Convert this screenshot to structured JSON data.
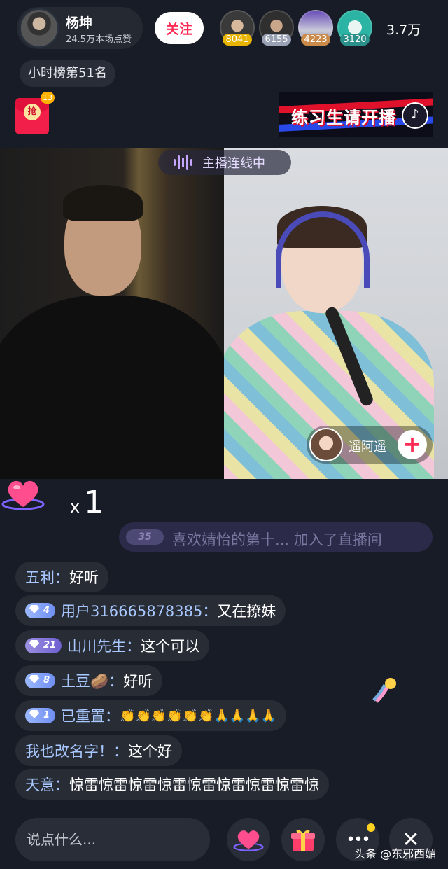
{
  "host": {
    "name": "杨坤",
    "likes": "24.5万本场点赞",
    "follow_label": "关注"
  },
  "viewers": [
    {
      "count": "8041",
      "badge_color": "#e8b400"
    },
    {
      "count": "6155",
      "badge_color": "#9aa3b5"
    },
    {
      "count": "4223",
      "badge_color": "#c98a4a"
    },
    {
      "count": "3120",
      "badge_color": "#2b8f8a"
    }
  ],
  "viewer_total": "3.7万",
  "rank": "小时榜第51名",
  "red_packet": {
    "label": "抢",
    "badge": "13"
  },
  "banner": {
    "text": "练习生请开播"
  },
  "link": {
    "status": "主播连线中"
  },
  "guest": {
    "name": "遥阿遥",
    "add_label": "+"
  },
  "like_combo": {
    "x": "x",
    "count": "1"
  },
  "join": {
    "level": "35",
    "text": "喜欢婧怡的第十... 加入了直播间"
  },
  "comments": [
    {
      "user": "五利",
      "sep": "：",
      "text": "好听"
    },
    {
      "level": "4",
      "user": "用户316665878385",
      "sep": "：",
      "text": "又在撩妹"
    },
    {
      "level": "21",
      "user": "山川先生",
      "sep": "：",
      "text": "这个可以"
    },
    {
      "level": "8",
      "user": "土豆🥔",
      "sep": "：",
      "text": "好听"
    },
    {
      "level": "1",
      "user": "已重置",
      "sep": "：",
      "text": "👏👏👏👏👏👏🙏🙏🙏🙏"
    },
    {
      "user": "我也改名字！",
      "sep": "：",
      "text": "这个好"
    },
    {
      "user": "天意",
      "sep": "：",
      "text": "惊雷惊雷惊雷惊雷惊雷惊雷惊雷惊雷惊"
    }
  ],
  "input": {
    "placeholder": "说点什么..."
  },
  "bottom": {
    "more_label": "•••",
    "close_label": "✕"
  },
  "watermark": "头条 @东邪西媚",
  "colors": {
    "accent": "#fe2c55",
    "username": "#a8c8ff",
    "background": "#171c26"
  }
}
